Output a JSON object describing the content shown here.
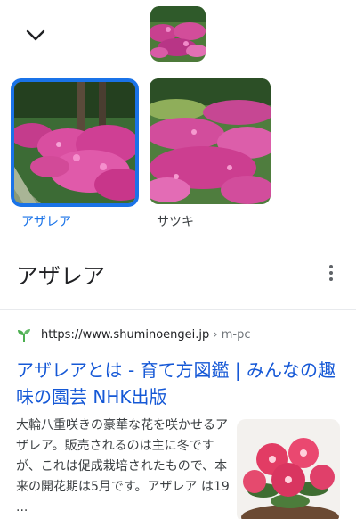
{
  "header": {
    "collapse_icon": "chevron-down-icon",
    "query_image": "azalea-garden-thumbnail"
  },
  "candidates": [
    {
      "label": "アザレア",
      "selected": true
    },
    {
      "label": "サツキ",
      "selected": false
    }
  ],
  "result": {
    "heading": "アザレア",
    "more_icon": "more-vert-icon",
    "source": {
      "url": "https://www.shuminoengei.jp",
      "path": "› m-pc",
      "favicon": "sprout-icon"
    },
    "title": "アザレアとは - 育て方図鑑 | みんなの趣味の園芸 NHK出版",
    "snippet": "大輪八重咲きの豪華な花を咲かせるアザレア。販売されるのは主に冬ですが、これは促成栽培されたもので、本来の開花期は5月です。アザレア は19 ..."
  },
  "colors": {
    "accent": "#1a73e8",
    "link": "#1558d6"
  }
}
